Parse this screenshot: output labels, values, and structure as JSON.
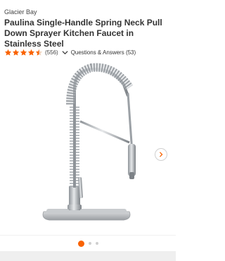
{
  "product": {
    "brand": "Glacier Bay",
    "title": "Paulina Single-Handle Spring Neck Pull Down Sprayer Kitchen Faucet in Stainless Steel",
    "rating": 4.5,
    "rating_max": 5,
    "review_count": "(556)",
    "qa_label": "Questions & Answers (53)"
  },
  "carousel": {
    "dots": 3,
    "active_index": 0
  },
  "icons": {
    "star": "star-icon",
    "chevron": "chevron-down-icon",
    "next": "chevron-right-icon"
  },
  "colors": {
    "accent": "#f96302",
    "star": "#f96302",
    "text": "#333333"
  }
}
